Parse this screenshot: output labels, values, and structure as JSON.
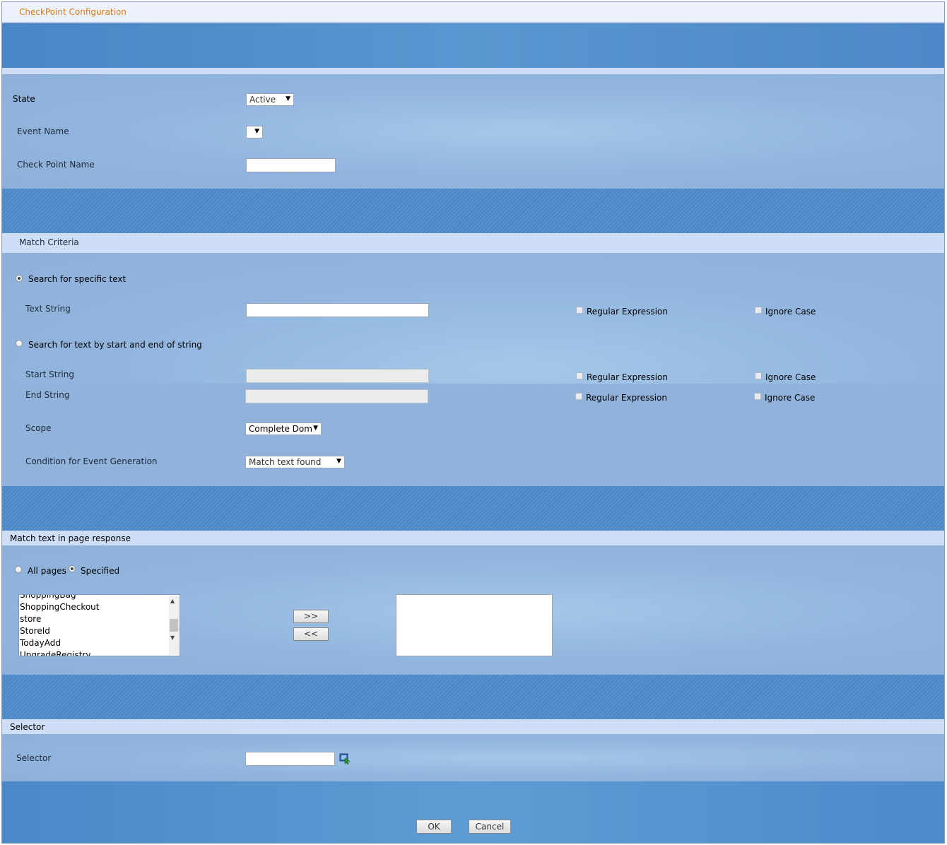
{
  "window": {
    "title": "CheckPoint Configuration"
  },
  "general": {
    "state_label": "State",
    "state_value": "Active",
    "event_name_label": "Event Name",
    "event_name_value": "",
    "checkpoint_name_label": "Check Point Name",
    "checkpoint_name_value": ""
  },
  "match_criteria": {
    "header": "Match Criteria",
    "search_specific_label": "Search for specific text",
    "search_specific_selected": true,
    "text_string_label": "Text String",
    "text_string_value": "",
    "regex_label": "Regular Expression",
    "ignore_case_label": "Ignore Case",
    "search_start_end_label": "Search for text by start and end of string",
    "search_start_end_selected": false,
    "start_string_label": "Start String",
    "end_string_label": "End String",
    "scope_label": "Scope",
    "scope_value": "Complete Dom",
    "condition_label": "Condition for Event Generation",
    "condition_value": "Match text found"
  },
  "page_response": {
    "header": "Match text in page response",
    "all_pages_label": "All pages",
    "specified_label": "Specified",
    "available_pages": [
      "ShoppingBag",
      "ShoppingCheckout",
      "store",
      "StoreId",
      "TodayAdd",
      "UpgradeRegistry"
    ],
    "add_button": ">>",
    "remove_button": "<<",
    "selected_pages": []
  },
  "selector": {
    "header": "Selector",
    "selector_label": "Selector",
    "selector_value": ""
  },
  "actions": {
    "ok": "OK",
    "cancel": "Cancel"
  },
  "colors": {
    "title": "#e07a10",
    "band": "#4e88c8",
    "panel": "#91b5de",
    "section_header": "#cfdef7"
  }
}
